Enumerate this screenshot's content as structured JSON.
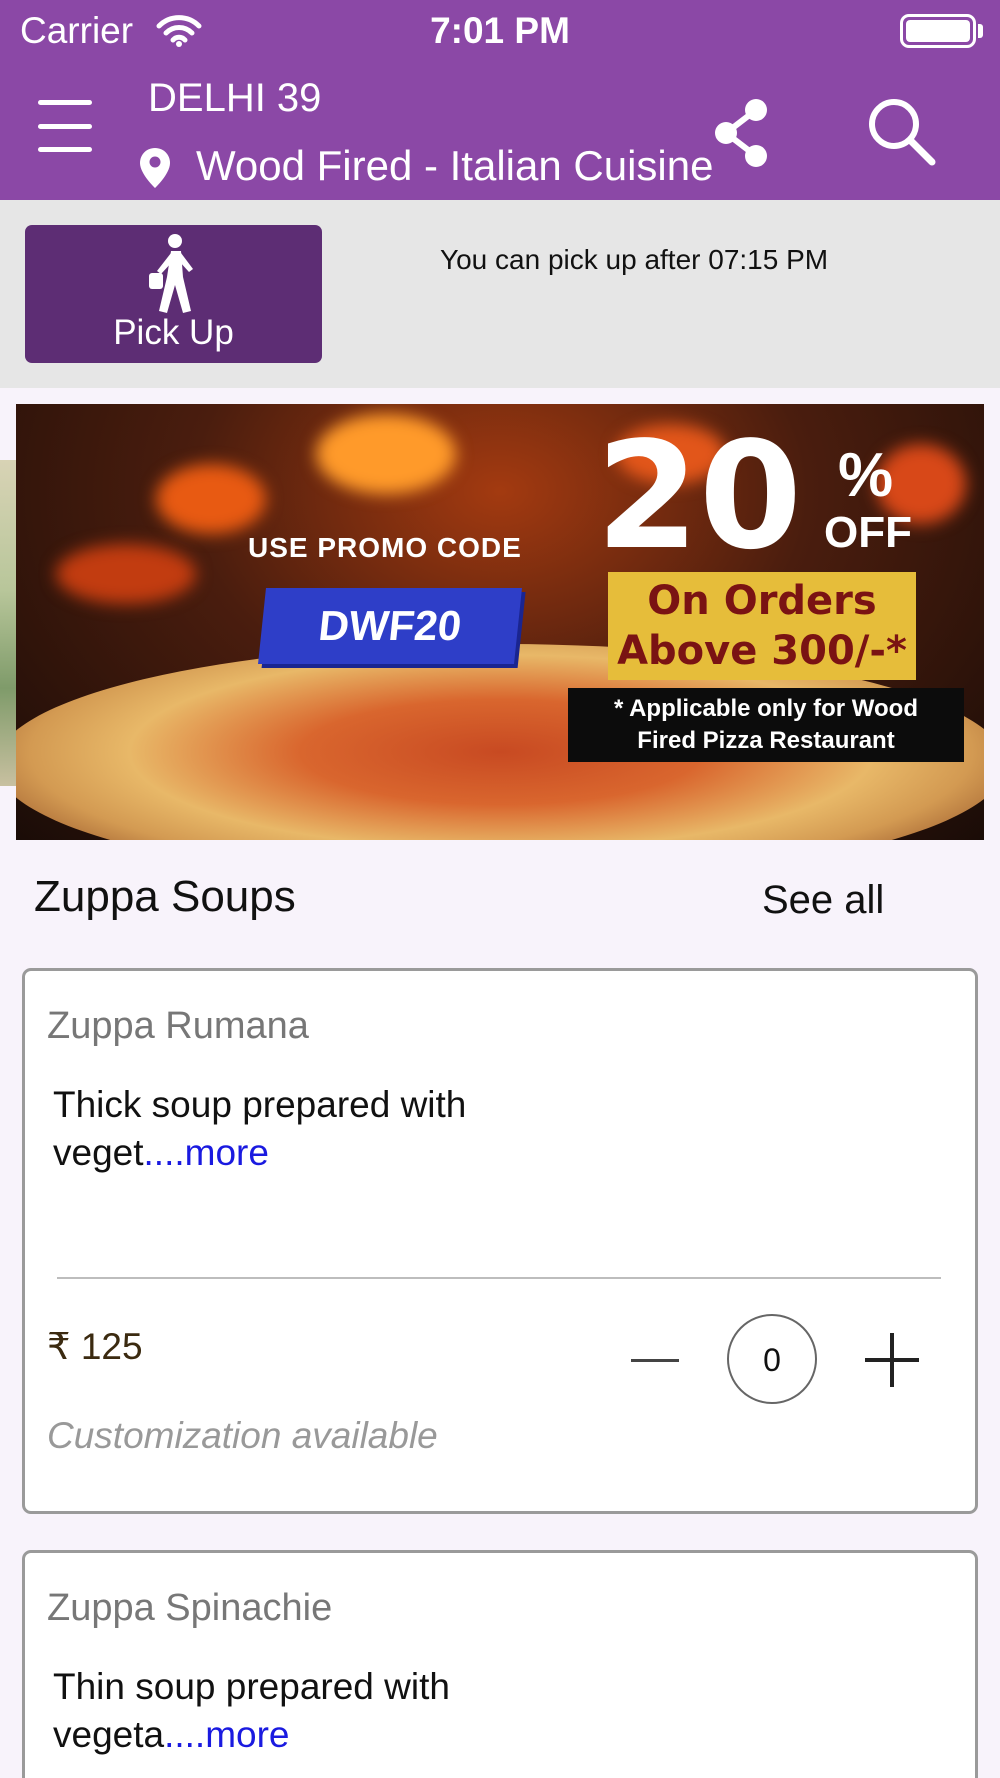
{
  "status_bar": {
    "carrier": "Carrier",
    "time": "7:01 PM"
  },
  "header": {
    "city": "DELHI 39",
    "restaurant": "Wood Fired - Italian Cuisine"
  },
  "pickup": {
    "button_label": "Pick Up",
    "note": "You can pick up after 07:15 PM"
  },
  "banner": {
    "promo_label": "USE PROMO CODE",
    "promo_code": "DWF20",
    "discount": "20",
    "percent": "%",
    "off": "OFF",
    "orders_line1": "On Orders",
    "orders_line2": "Above 300/-*",
    "note_line1": "* Applicable only for Wood",
    "note_line2": "Fired Pizza Restaurant"
  },
  "section": {
    "title": "Zuppa Soups",
    "see_all": "See all"
  },
  "items": [
    {
      "name": "Zuppa Rumana",
      "desc": "Thick soup prepared with veget",
      "more": "....more",
      "price": "₹ 125",
      "qty": "0",
      "customization": "Customization available"
    },
    {
      "name": "Zuppa Spinachie",
      "desc": "Thin soup prepared with vegeta",
      "more": "....more"
    }
  ],
  "colors": {
    "header": "#8b48a6",
    "pickup_button": "#5d2d74",
    "link": "#1a1ae0"
  },
  "icons": [
    "wifi-icon",
    "battery-icon",
    "menu-icon",
    "location-pin-icon",
    "share-icon",
    "search-icon",
    "walking-person-icon",
    "minus-icon",
    "plus-icon"
  ]
}
